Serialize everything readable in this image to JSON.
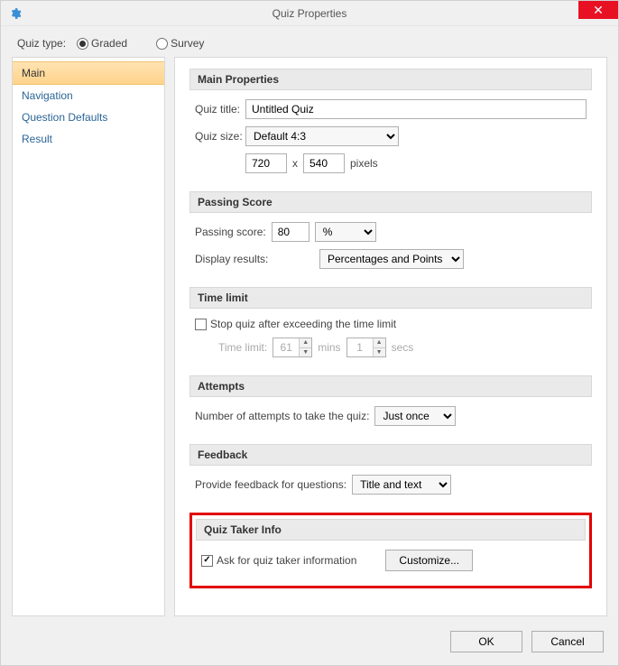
{
  "window": {
    "title": "Quiz Properties"
  },
  "quiztype": {
    "label": "Quiz type:",
    "graded": "Graded",
    "survey": "Survey"
  },
  "sidebar": {
    "items": [
      {
        "label": "Main"
      },
      {
        "label": "Navigation"
      },
      {
        "label": "Question Defaults"
      },
      {
        "label": "Result"
      }
    ]
  },
  "sections": {
    "main_props": {
      "header": "Main Properties",
      "quiz_title_label": "Quiz title:",
      "quiz_title_value": "Untitled Quiz",
      "quiz_size_label": "Quiz size:",
      "quiz_size_value": "Default 4:3",
      "width_value": "720",
      "x_label": "x",
      "height_value": "540",
      "pixels_label": "pixels"
    },
    "passing": {
      "header": "Passing Score",
      "score_label": "Passing score:",
      "score_value": "80",
      "unit_value": "%",
      "display_label": "Display results:",
      "display_value": "Percentages and Points"
    },
    "timelimit": {
      "header": "Time limit",
      "stop_label": "Stop quiz after exceeding the time limit",
      "time_label": "Time limit:",
      "mins_value": "61",
      "mins_label": "mins",
      "secs_value": "1",
      "secs_label": "secs"
    },
    "attempts": {
      "header": "Attempts",
      "label": "Number of attempts to take the quiz:",
      "value": "Just once"
    },
    "feedback": {
      "header": "Feedback",
      "label": "Provide feedback for questions:",
      "value": "Title and text"
    },
    "taker": {
      "header": "Quiz Taker Info",
      "ask_label": "Ask for quiz taker information",
      "customize": "Customize..."
    }
  },
  "footer": {
    "ok": "OK",
    "cancel": "Cancel"
  }
}
